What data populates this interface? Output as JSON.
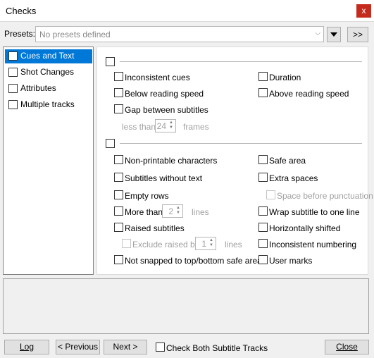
{
  "window": {
    "title": "Checks",
    "close_glyph": "x"
  },
  "presets": {
    "label": "Presets:",
    "value": "No presets defined",
    "next_label": ">>"
  },
  "tree": [
    {
      "label": "Cues and Text"
    },
    {
      "label": "Shot Changes"
    },
    {
      "label": "Attributes"
    },
    {
      "label": "Multiple tracks"
    }
  ],
  "cues": {
    "inconsistent_cues": "Inconsistent cues",
    "duration": "Duration",
    "below_reading_speed": "Below reading speed",
    "above_reading_speed": "Above reading speed",
    "gap_between_subtitles": "Gap between subtitles",
    "less_than": "less than",
    "gap_value": "24",
    "frames": "frames"
  },
  "text": {
    "non_printable": "Non-printable characters",
    "safe_area": "Safe area",
    "without_text": "Subtitles without text",
    "extra_spaces": "Extra spaces",
    "empty_rows": "Empty rows",
    "space_before_punctuation": "Space before punctuation",
    "more_than": "More than",
    "more_than_value": "2",
    "lines": "lines",
    "wrap_one_line": "Wrap subtitle to one line",
    "raised": "Raised subtitles",
    "horizontally_shifted": "Horizontally shifted",
    "exclude_raised_by": "Exclude raised by",
    "exclude_value": "1",
    "inconsistent_numbering": "Inconsistent numbering",
    "not_snapped": "Not snapped to top/bottom safe area",
    "user_marks": "User marks"
  },
  "footer": {
    "log": "Log",
    "previous": "< Previous",
    "next": "Next >",
    "check_both": "Check Both Subtitle Tracks",
    "close": "Close"
  }
}
